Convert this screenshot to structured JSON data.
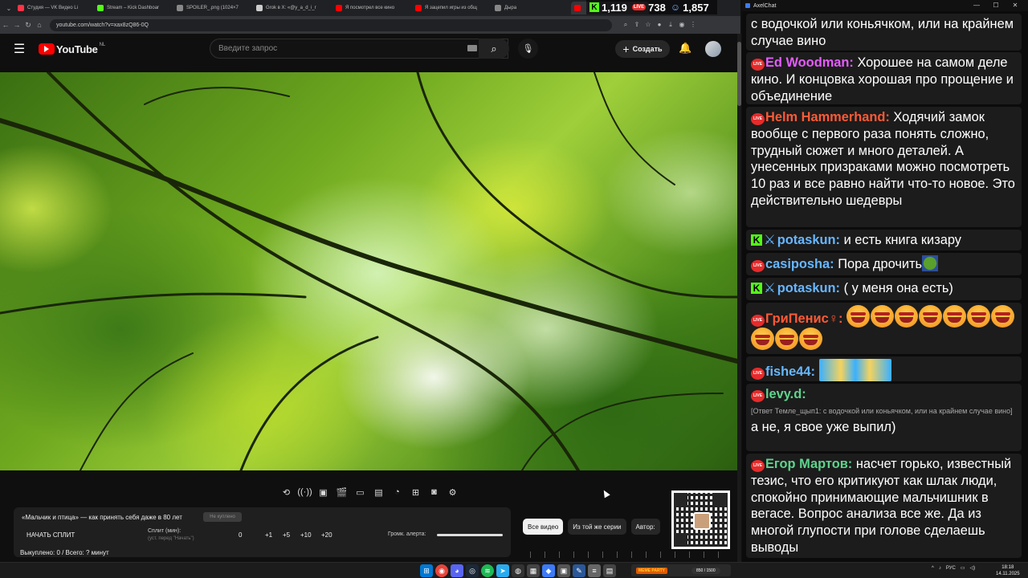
{
  "browser": {
    "tabs": [
      {
        "label": "Студия — VK Видео Li",
        "color": "#ff3347"
      },
      {
        "label": "Stream – Kick Dashboar",
        "color": "#53fc18"
      },
      {
        "label": "SPOILER_.png (1024×7",
        "color": "#888888"
      },
      {
        "label": "Grok в X: «@y_a_d_i_r",
        "color": "#cccccc"
      },
      {
        "label": "Я посмотрел все кино",
        "color": "#ff0000"
      },
      {
        "label": "Я зацепил игры из общ",
        "color": "#ff0000"
      },
      {
        "label": "Дыра",
        "color": "#888888"
      },
      {
        "label": "",
        "color": "#ff0000"
      }
    ],
    "url": "youtube.com/watch?v=xax8zQ86-0Q"
  },
  "stream_stats": {
    "kick_viewers": "1,119",
    "live_viewers": "738",
    "total_viewers": "1,857"
  },
  "youtube": {
    "logo_text": "YouTube",
    "country": "NL",
    "search_placeholder": "Введите запрос",
    "create_label": "Создать"
  },
  "split_panel": {
    "title": "«Мальчик и птица» — как принять себя даже в 80 лет",
    "badge": "Не куплено",
    "start_label": "НАЧАТЬ СПЛИТ",
    "split_label": "Сплит (мин):",
    "split_hint": "(уст. перед \"Начать\")",
    "split_value": "0",
    "increments": [
      "+1",
      "+5",
      "+10",
      "+20"
    ],
    "alert_volume_label": "Громк. алерта:",
    "alert_volume": 1.0,
    "bought_text": "Выкуплено: 0 / Всего: ? минут"
  },
  "chips": [
    "Все видео",
    "Из той же серии",
    "Автор:"
  ],
  "chat": {
    "app_title": "AxelChat",
    "messages": [
      {
        "user": "",
        "text": "с водочкой или коньячком, или на крайнем случае вино"
      },
      {
        "user": "Ed Woodman:",
        "color": "#e65cff",
        "text": "Хорошее на самом деле кино. И концовка хорошая про прощение и объединение"
      },
      {
        "user": "Helm Hammerhand:",
        "color": "#ff5a36",
        "text": "Ходячий замок вообще с первого раза понять сложно, трудный сюжет и много деталей. А унесенных призраками можно посмотреть 10 раз и все равно найти что-то новое. Это действительно шедевры"
      },
      {
        "user": "potaskun:",
        "color": "#67b7ff",
        "text": "и есть книга кизару"
      },
      {
        "user": "casiposha:",
        "color": "#67b7ff",
        "text": "Пора дрочить"
      },
      {
        "user": "potaskun:",
        "color": "#67b7ff",
        "text": "( у меня она есть)"
      },
      {
        "user": "ГриПенис♀:",
        "color": "#ff5a36",
        "text": ""
      },
      {
        "user": "fishe44:",
        "color": "#67b7ff",
        "text": ""
      },
      {
        "user": "levy.d:",
        "color": "#5fd38d",
        "reply": "[Ответ Темле_щып1: с водочкой или коньячком, или на крайнем случае вино]",
        "text": "а не, я свое уже выпил)"
      },
      {
        "user": "Егор Мартов:",
        "color": "#5fd38d",
        "text": "насчет горько, известный тезис, что его критикуют как шлак люди, спокойно принимающие мальчишник в вегасе. Вопрос анализа все же. Да из многой глупости при голове сделаешь выводы"
      }
    ]
  },
  "taskbar": {
    "widget_label": "MEME PARTY",
    "widget_count": "850 / 1500",
    "lang": "РУС",
    "time": "18:18",
    "date": "14.11.2025"
  }
}
